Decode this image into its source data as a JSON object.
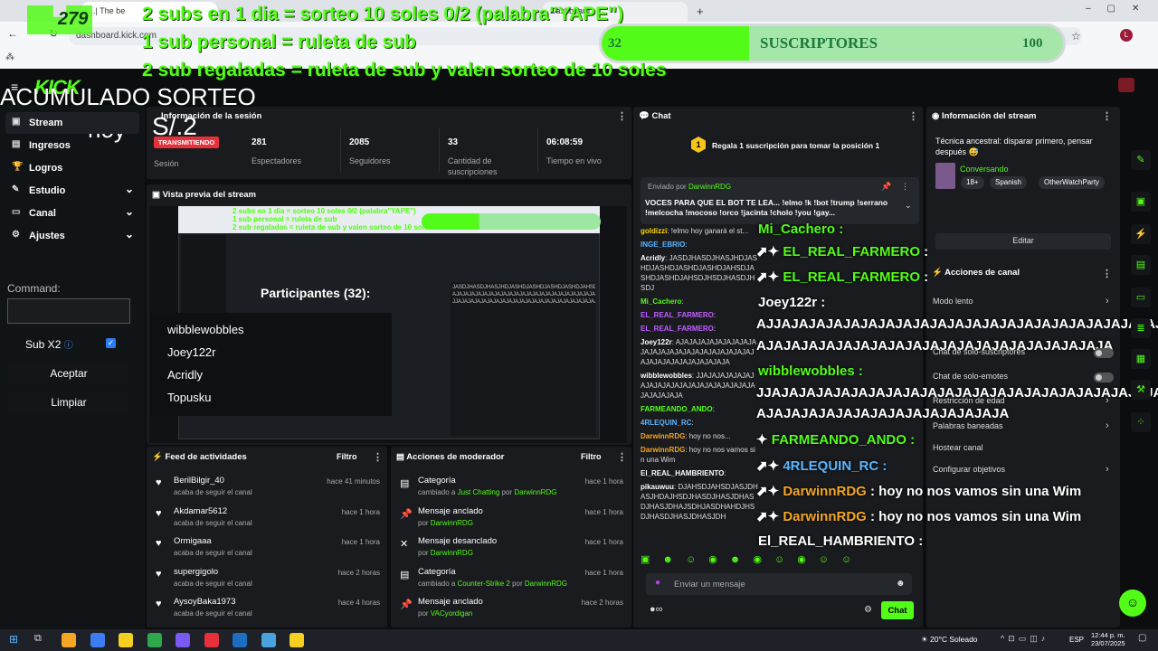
{
  "browser": {
    "tab1": "Dashboard | Kick",
    "tab2": "...| The be",
    "tab3": "Dashboard",
    "url": "dashboard.kick.com"
  },
  "overlay": {
    "counter_badge": "279",
    "line1": "2 subs en 1 dia = sorteo 10  soles   0/2 (palabra\"YAPE\")",
    "line2": "1 sub personal = ruleta de sub",
    "line3": "2 sub regaladas = ruleta de sub y valen sorteo de 10 soles",
    "sub_current": "32",
    "sub_label": "SUSCRIPTORES",
    "sub_goal": "100",
    "sub_progress": 0.32,
    "acumulado": "ACUMULADO SORTEO",
    "hoy": "hoy",
    "amount": "S/.2"
  },
  "header": {
    "logo": "KICK",
    "beta": "BETA"
  },
  "sidebar": {
    "items": [
      {
        "label": "Stream",
        "icon": "▣"
      },
      {
        "label": "Ingresos",
        "icon": "▤"
      },
      {
        "label": "Logros",
        "icon": "🏆"
      },
      {
        "label": "Estudio",
        "icon": "✎"
      },
      {
        "label": "Canal",
        "icon": "▭"
      },
      {
        "label": "Ajustes",
        "icon": "⚙"
      }
    ],
    "command_label": "Command:",
    "sub_x2": "Sub X2",
    "accept": "Aceptar",
    "clear": "Limpiar"
  },
  "session": {
    "title": "Información de la sesión",
    "status": "TRANSMITIENDO",
    "status_label": "Sesión",
    "stats": [
      {
        "value": "281",
        "label": "Espectadores"
      },
      {
        "value": "2085",
        "label": "Seguidores"
      },
      {
        "value": "33",
        "label": "Cantidad de suscripciones"
      },
      {
        "value": "06:08:59",
        "label": "Tiempo en vivo"
      }
    ]
  },
  "preview": {
    "title": "Vista previa del stream",
    "participants_title": "Participantes (32):",
    "participants": [
      "wibblewobbles",
      "Joey122r",
      "Acridly",
      "Topusku"
    ]
  },
  "feed": {
    "title": "Feed de actividades",
    "filter": "Filtro",
    "rows": [
      {
        "name": "BerilBilgir_40",
        "sub": "acaba de seguir el canal",
        "time": "hace 41 minutos"
      },
      {
        "name": "Akdamar5612",
        "sub": "acaba de seguir el canal",
        "time": "hace 1 hora"
      },
      {
        "name": "Ormigaaa",
        "sub": "acaba de seguir el canal",
        "time": "hace 1 hora"
      },
      {
        "name": "supergigolo",
        "sub": "acaba de seguir el canal",
        "time": "hace 2 horas"
      },
      {
        "name": "AysoyBaka1973",
        "sub": "acaba de seguir el canal",
        "time": "hace 4 horas"
      }
    ]
  },
  "modactions": {
    "title": "Acciones de moderador",
    "filter": "Filtro",
    "rows": [
      {
        "name": "Categoría",
        "pre": "cambiado a",
        "hl": "Just Chatting",
        "mid": "por",
        "user": "DarwinnRDG",
        "time": "hace 1 hora"
      },
      {
        "name": "Mensaje anclado",
        "pre": "por",
        "user": "DarwinnRDG",
        "time": "hace 1 hora"
      },
      {
        "name": "Mensaje desanclado",
        "pre": "por",
        "user": "DarwinnRDG",
        "time": "hace 1 hora"
      },
      {
        "name": "Categoría",
        "pre": "cambiado a",
        "hl": "Counter-Strike 2",
        "mid": "por",
        "user": "DarwinnRDG",
        "time": "hace 1 hora"
      },
      {
        "name": "Mensaje anclado",
        "pre": "por",
        "user": "VACyordigan",
        "time": "hace 2 horas"
      }
    ]
  },
  "chat": {
    "title": "Chat",
    "gift_text": "Regala 1 suscripción para tomar la posición 1",
    "pinned_by": "Enviado por",
    "pinned_user": "DarwinnRDG",
    "pinned_text": "VOCES PARA QUE EL BOT TE LEA... !elmo !k !bot !trump !serrano !melcocha !mocoso !orco !jacinta !cholo !you !gay...",
    "lines": [
      {
        "user": "goldizzi",
        "text": "!elmo hoy ganará el st..."
      },
      {
        "user": "INGE_EBRIO",
        "text": ""
      },
      {
        "user": "Acridly",
        "text": "JASDJHASDJHASJHDJASHDJASHDJASHDJASHDJAHSDJASHDJASHDJAHSDJHSDJHASDJHSDJ"
      },
      {
        "user": "Mi_Cachero",
        "text": ""
      },
      {
        "user": "EL_REAL_FARMERO",
        "text": ""
      },
      {
        "user": "EL_REAL_FARMERO",
        "text": ""
      },
      {
        "user": "Joey122r",
        "text": "AJAJAJAJAJAJAJAJAJAJAJAJAJAJAJAJAJAJAJAJAJAJAJAJAJAJAJAJAJAJAJAJAJA"
      },
      {
        "user": "wibblewobbles",
        "text": "JJAJAJAJAJAJAJAJAJAJAJAJAJAJAJAJAJAJAJAJAJAJAJAJAJA"
      },
      {
        "user": "FARMEANDO_ANDO",
        "text": ""
      },
      {
        "user": "4RLEQUIN_RC",
        "text": ""
      },
      {
        "user": "DarwinnRDG",
        "text": "hoy no nos..."
      },
      {
        "user": "DarwinnRDG",
        "text": "hoy no nos vamos sin una Wim"
      },
      {
        "user": "El_REAL_HAMBRIENTO",
        "text": ""
      },
      {
        "user": "pikauwuu",
        "text": "DJAHSDJAHSDJASJDHASJHDAJHSDJHASDJHASJDHASDJHASJDHAJSDHJASDHAHDJHSDJHASDJHASJDHASJDH"
      }
    ],
    "input_placeholder": "Enviar un mensaje",
    "send": "Chat"
  },
  "tts": {
    "mi_cachero": "Mi_Cachero :",
    "farmero1": "EL_REAL_FARMERO",
    "farmero2": "EL_REAL_FARMERO",
    "joey": "Joey122r :",
    "joey_text1": "AJJAJAJAJAJAJAJAJAJAJAJAJAJAJAJAJAJAJAJAJAJAJAJJ",
    "joey_text2": "AJAJAJAJAJAJAJAJAJAJAJAJAJAJAJAJAJAJAJAJA",
    "wibble": "wibblewobbles :",
    "wibble_text1": "JJAJAJAJAJAJAJAJAJAJAJAJAJAJAJAJAJAJAJAJAJAJAJAJA",
    "wibble_text2": "AJAJAJAJAJAJAJAJAJAJAJAJAJAJA",
    "farmeando": "FARMEANDO_ANDO :",
    "arlequin": "4RLEQUIN_RC :",
    "darwin1": "DarwinnRDG",
    "darwin1_text": ": hoy no nos vamos sin una Wim",
    "darwin2": "DarwinnRDG",
    "darwin2_text": ": hoy no nos vamos sin una Wim",
    "hambriento": "El_REAL_HAMBRIENTO :"
  },
  "info": {
    "title": "Información del stream",
    "stream_title": "Técnica ancestral: disparar primero, pensar después 😅",
    "category": "Conversando",
    "tags": [
      "18+",
      "Spanish",
      "OtherWatchParty"
    ],
    "edit": "Editar",
    "actions_title": "Acciones de canal",
    "actions": [
      {
        "label": "Modo lento"
      },
      {
        "label": "Chat de solo-suscriptores"
      },
      {
        "label": "Chat de solo-emotes"
      },
      {
        "label": "Restricción de edad"
      },
      {
        "label": "Palabras baneadas"
      },
      {
        "label": "Hostear canal"
      },
      {
        "label": "Configurar objetivos"
      }
    ]
  },
  "taskbar": {
    "weather": "20°C  Soleado",
    "lang": "ESP",
    "time": "12:44 p. m.",
    "date": "23/07/2025"
  },
  "colors": {
    "accent": "#53fc18",
    "live": "#e8303a",
    "panel": "#191b1f"
  }
}
